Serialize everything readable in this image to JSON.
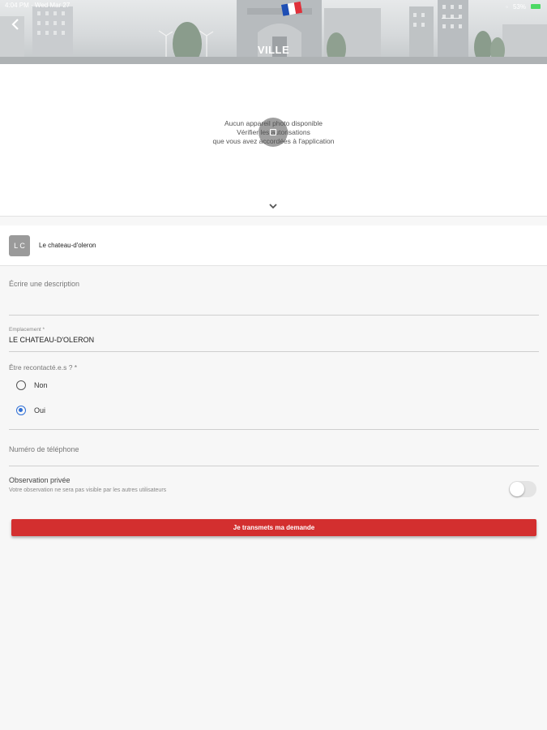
{
  "status_bar": {
    "time": "4:04 PM",
    "date": "Wed Mar 27",
    "battery": "53%"
  },
  "header": {
    "title": "VILLE",
    "back_icon": "chevron-left-icon"
  },
  "map": {
    "message_line1": "Aucun appareil photo disponible",
    "message_line2": "Vérifier les autorisations",
    "message_line3": "que vous avez accordées à l'application",
    "expand_icon": "chevron-down-icon"
  },
  "location": {
    "initials": "L C",
    "name": "Le chateau-d'oleron"
  },
  "form": {
    "description_placeholder": "Écrire une description",
    "location_label": "Emplacement *",
    "location_value": "LE CHATEAU-D'OLERON",
    "contact_label": "Être recontacté.e.s ? *",
    "option_no": "Non",
    "option_yes": "Oui",
    "selected_option": "Oui",
    "phone_placeholder": "Numéro de téléphone",
    "private_title": "Observation privée",
    "private_desc": "Votre observation ne sera pas visible par les autres utilisateurs",
    "private_enabled": false,
    "submit_label": "Je transmets ma demande"
  },
  "colors": {
    "accent": "#d32f2f",
    "radio": "#2f6fd6",
    "flag_blue": "#1f4fb5",
    "flag_red": "#e0303a"
  }
}
